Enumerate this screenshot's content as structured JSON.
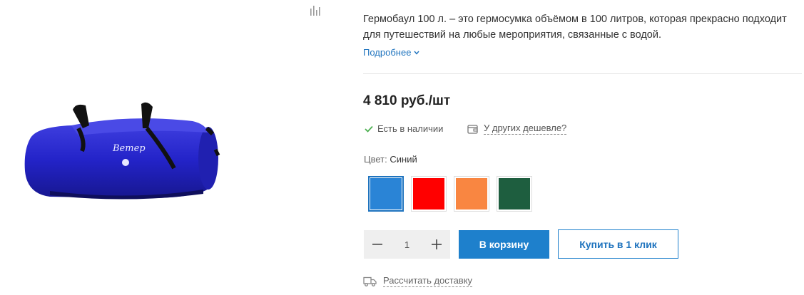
{
  "product": {
    "description": "Гермобаул 100 л. – это гермосумка объёмом в 100 литров, которая прекрасно подходит для путешествий на любые мероприятия, связанные с водой.",
    "more_label": "Подробнее",
    "price": "4 810 руб./шт",
    "availability": "Есть в наличии",
    "cheaper_label": "У других дешевле?",
    "image_logo_text": "Ветер",
    "image_icon": "blue-duffel-bag"
  },
  "color": {
    "label": "Цвет:",
    "selected": "Синий",
    "options": [
      {
        "name": "Синий",
        "hex": "#2a84d6"
      },
      {
        "name": "Красный",
        "hex": "#ff0000"
      },
      {
        "name": "Оранжевый",
        "hex": "#f98641"
      },
      {
        "name": "Зелёный",
        "hex": "#1e5e3f"
      }
    ]
  },
  "quantity": {
    "value": "1",
    "minus_icon": "minus-icon",
    "plus_icon": "plus-icon"
  },
  "actions": {
    "cart_label": "В корзину",
    "oneclick_label": "Купить в 1 клик",
    "delivery_label": "Рассчитать доставку"
  },
  "icons": {
    "compare": "compare-icon",
    "check": "check-icon",
    "wallet": "wallet-icon",
    "truck": "truck-icon",
    "chevron": "chevron-down-icon"
  },
  "colors": {
    "accent": "#1e80cc",
    "link": "#1e73be",
    "check": "#4caf50"
  }
}
